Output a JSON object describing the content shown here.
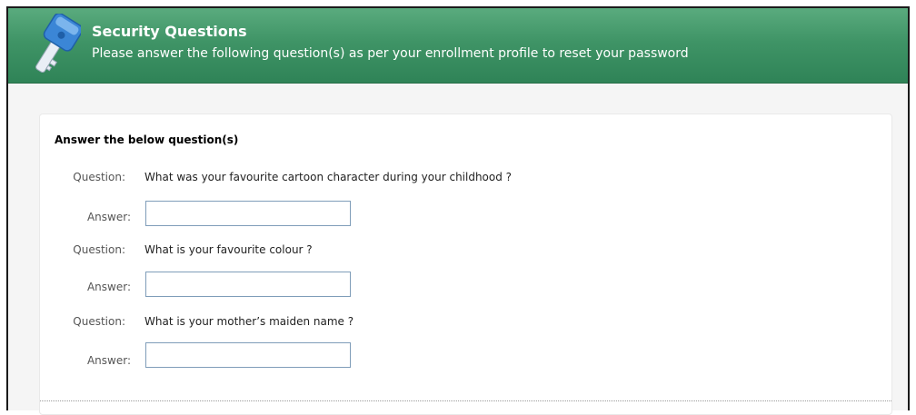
{
  "header": {
    "title": "Security Questions",
    "subtitle": "Please answer the following question(s) as per your enrollment profile to reset your password",
    "icon": "key-icon",
    "color": "#3f9466"
  },
  "form": {
    "heading": "Answer the below question(s)",
    "question_label": "Question:",
    "answer_label": "Answer:",
    "items": [
      {
        "question": "What was your favourite cartoon character during your childhood ?",
        "answer": ""
      },
      {
        "question": "What is your favourite colour ?",
        "answer": ""
      },
      {
        "question": "What is your mother’s maiden name ?",
        "answer": ""
      }
    ]
  }
}
